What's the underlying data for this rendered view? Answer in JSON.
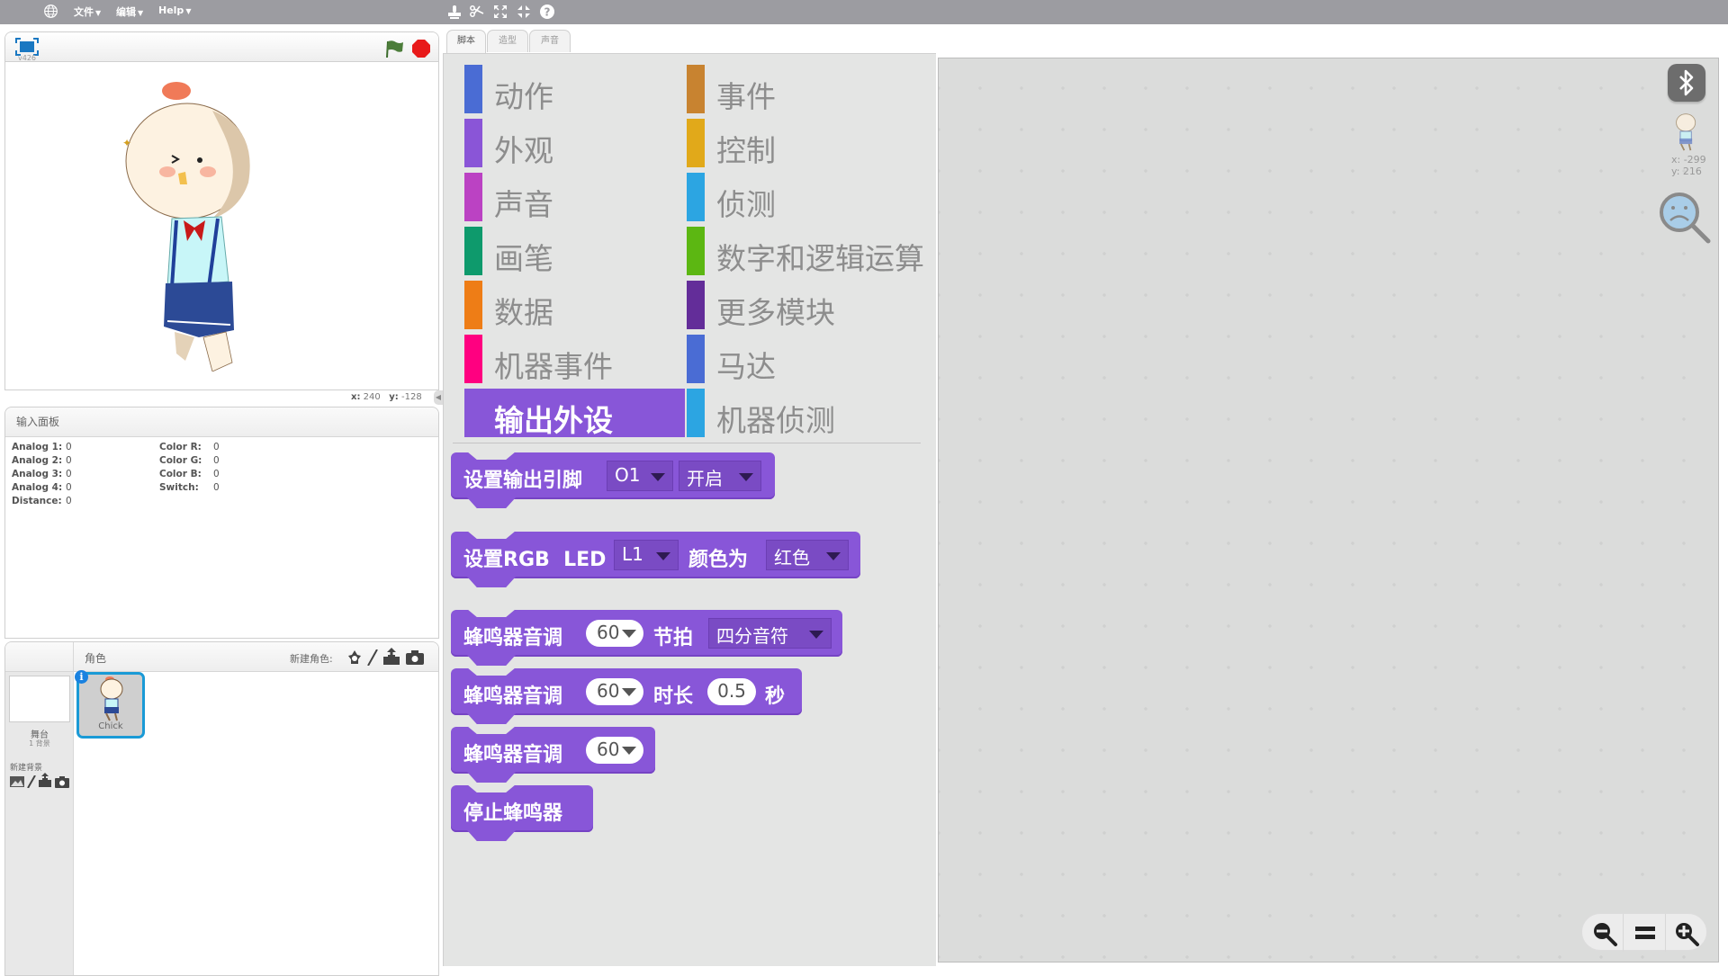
{
  "menubar": {
    "globe_icon": "globe-icon",
    "menus": [
      {
        "label": "文件"
      },
      {
        "label": "编辑"
      },
      {
        "label": "Help"
      }
    ],
    "tools": [
      "stamp-icon",
      "cut-icon",
      "grow-icon",
      "shrink-icon",
      "help-icon"
    ]
  },
  "stage": {
    "version": "v426",
    "coords": {
      "x_label": "x:",
      "x": "240",
      "y_label": "y:",
      "y": "-128"
    },
    "sprite_name": "Chick"
  },
  "input_panel": {
    "title": "输入面板",
    "left": [
      {
        "label": "Analog 1:",
        "value": "0"
      },
      {
        "label": "Analog 2:",
        "value": "0"
      },
      {
        "label": "Analog 3:",
        "value": "0"
      },
      {
        "label": "Analog 4:",
        "value": "0"
      },
      {
        "label": "Distance:",
        "value": "0"
      }
    ],
    "right": [
      {
        "label": "Color R:",
        "value": "0"
      },
      {
        "label": "Color G:",
        "value": "0"
      },
      {
        "label": "Color B:",
        "value": "0"
      },
      {
        "label": "Switch:",
        "value": "0"
      }
    ]
  },
  "sprite_panel": {
    "title": "角色",
    "new_sprite_label": "新建角色:",
    "stage_label": "舞台",
    "backdrop_count": "1 背景",
    "new_backdrop_label": "新建背景",
    "sprites": [
      {
        "name": "Chick",
        "selected": true
      }
    ]
  },
  "tabs": [
    {
      "label": "脚本",
      "active": true
    },
    {
      "label": "造型",
      "active": false
    },
    {
      "label": "声音",
      "active": false
    }
  ],
  "categories": [
    {
      "label": "动作",
      "color": "#4a6cd4",
      "col": 0
    },
    {
      "label": "外观",
      "color": "#8a55d7",
      "col": 0
    },
    {
      "label": "声音",
      "color": "#bb42c3",
      "col": 0
    },
    {
      "label": "画笔",
      "color": "#0e9a6c",
      "col": 0
    },
    {
      "label": "数据",
      "color": "#ee7d16",
      "col": 0
    },
    {
      "label": "机器事件",
      "color": "#ff0080",
      "col": 0
    },
    {
      "label": "输出外设",
      "color": "#8856d8",
      "col": 0,
      "selected": true
    },
    {
      "label": "事件",
      "color": "#c88330",
      "col": 1
    },
    {
      "label": "控制",
      "color": "#e1a91a",
      "col": 1
    },
    {
      "label": "侦测",
      "color": "#2ca5e2",
      "col": 1
    },
    {
      "label": "数字和逻辑运算",
      "color": "#5cb712",
      "col": 1
    },
    {
      "label": "更多模块",
      "color": "#632d99",
      "col": 1
    },
    {
      "label": "马达",
      "color": "#4a6cd4",
      "col": 1
    },
    {
      "label": "机器侦测",
      "color": "#2ca5e2",
      "col": 1
    }
  ],
  "blocks": {
    "set_output_pin": {
      "label": "设置输出引脚",
      "pin": "O1",
      "state": "开启"
    },
    "set_rgb_led": {
      "label": "设置RGB  LED",
      "led": "L1",
      "color_label": "颜色为",
      "color": "红色"
    },
    "buzzer_beat": {
      "label": "蜂鸣器音调",
      "tone": "60",
      "beat_label": "节拍",
      "beat": "四分音符"
    },
    "buzzer_duration": {
      "label": "蜂鸣器音调",
      "tone": "60",
      "duration_label": "时长",
      "duration": "0.5",
      "unit": "秒"
    },
    "buzzer_tone": {
      "label": "蜂鸣器音调",
      "tone": "60"
    },
    "stop_buzzer": {
      "label": "停止蜂鸣器"
    }
  },
  "scripts_area": {
    "sprite_x": "x: -299",
    "sprite_y": "y: 216"
  },
  "colors": {
    "menubar": "#9c9ca1",
    "block": "#8856d8",
    "palette_bg": "#e4e5e4",
    "scripts_bg": "#dbdcdb"
  }
}
